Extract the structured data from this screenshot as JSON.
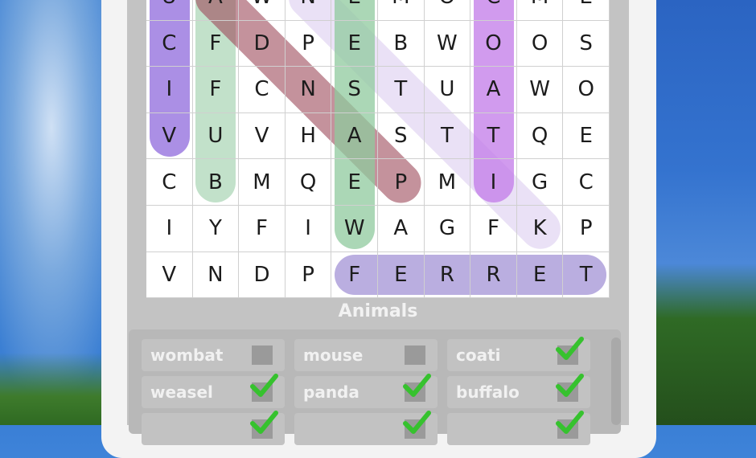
{
  "game": {
    "category_title": "Animals",
    "grid_rows": [
      [
        "U",
        "A",
        "W",
        "N",
        "E",
        "M",
        "O",
        "C",
        "M",
        "E"
      ],
      [
        "C",
        "F",
        "D",
        "P",
        "E",
        "B",
        "W",
        "O",
        "O",
        "S"
      ],
      [
        "I",
        "F",
        "C",
        "N",
        "S",
        "T",
        "U",
        "A",
        "W",
        "O"
      ],
      [
        "V",
        "U",
        "V",
        "H",
        "A",
        "S",
        "T",
        "T",
        "Q",
        "E"
      ],
      [
        "C",
        "B",
        "M",
        "Q",
        "E",
        "P",
        "M",
        "I",
        "G",
        "C"
      ],
      [
        "I",
        "Y",
        "F",
        "I",
        "W",
        "A",
        "G",
        "F",
        "K",
        "P"
      ],
      [
        "V",
        "N",
        "D",
        "P",
        "F",
        "E",
        "R",
        "R",
        "E",
        "T"
      ]
    ],
    "words": [
      {
        "label": "wombat",
        "found": false
      },
      {
        "label": "mouse",
        "found": false
      },
      {
        "label": "coati",
        "found": true
      },
      {
        "label": "weasel",
        "found": true
      },
      {
        "label": "panda",
        "found": true
      },
      {
        "label": "buffalo",
        "found": true
      },
      {
        "label": "",
        "found": true
      },
      {
        "label": "",
        "found": true
      },
      {
        "label": "",
        "found": true
      }
    ],
    "colors": {
      "highlight_purple": "#9c7be0",
      "highlight_green": "#8fc99e",
      "highlight_maroon": "#9c4a5a",
      "highlight_lilac": "#d9c8ef",
      "highlight_lavender": "#a99ad8",
      "highlight_violet": "#c27ae8",
      "check_green": "#36c22e"
    }
  }
}
